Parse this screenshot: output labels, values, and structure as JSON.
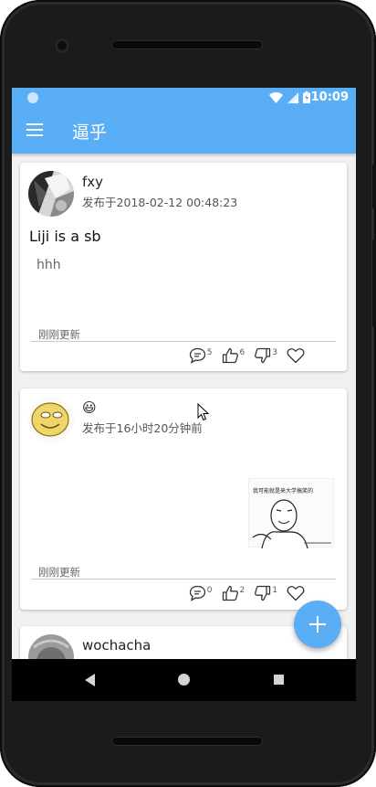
{
  "status": {
    "time": "10:09"
  },
  "app": {
    "title": "逼乎"
  },
  "posts": [
    {
      "author": "fxy",
      "time": "发布于2018-02-12 00:48:23",
      "title": "Liji is a sb",
      "body": "hhh",
      "updated": "刚刚更新",
      "comments": "5",
      "likes": "6",
      "dislikes": "3"
    },
    {
      "author": "😃",
      "time": "发布于16小时20分钟前",
      "updated": "刚刚更新",
      "comments": "0",
      "likes": "2",
      "dislikes": "1",
      "meme_caption": "我可能就是来大学搞笑的"
    },
    {
      "author": "wochacha"
    }
  ],
  "fab": {
    "icon": "plus-icon"
  },
  "colors": {
    "primary": "#5aaef6"
  }
}
